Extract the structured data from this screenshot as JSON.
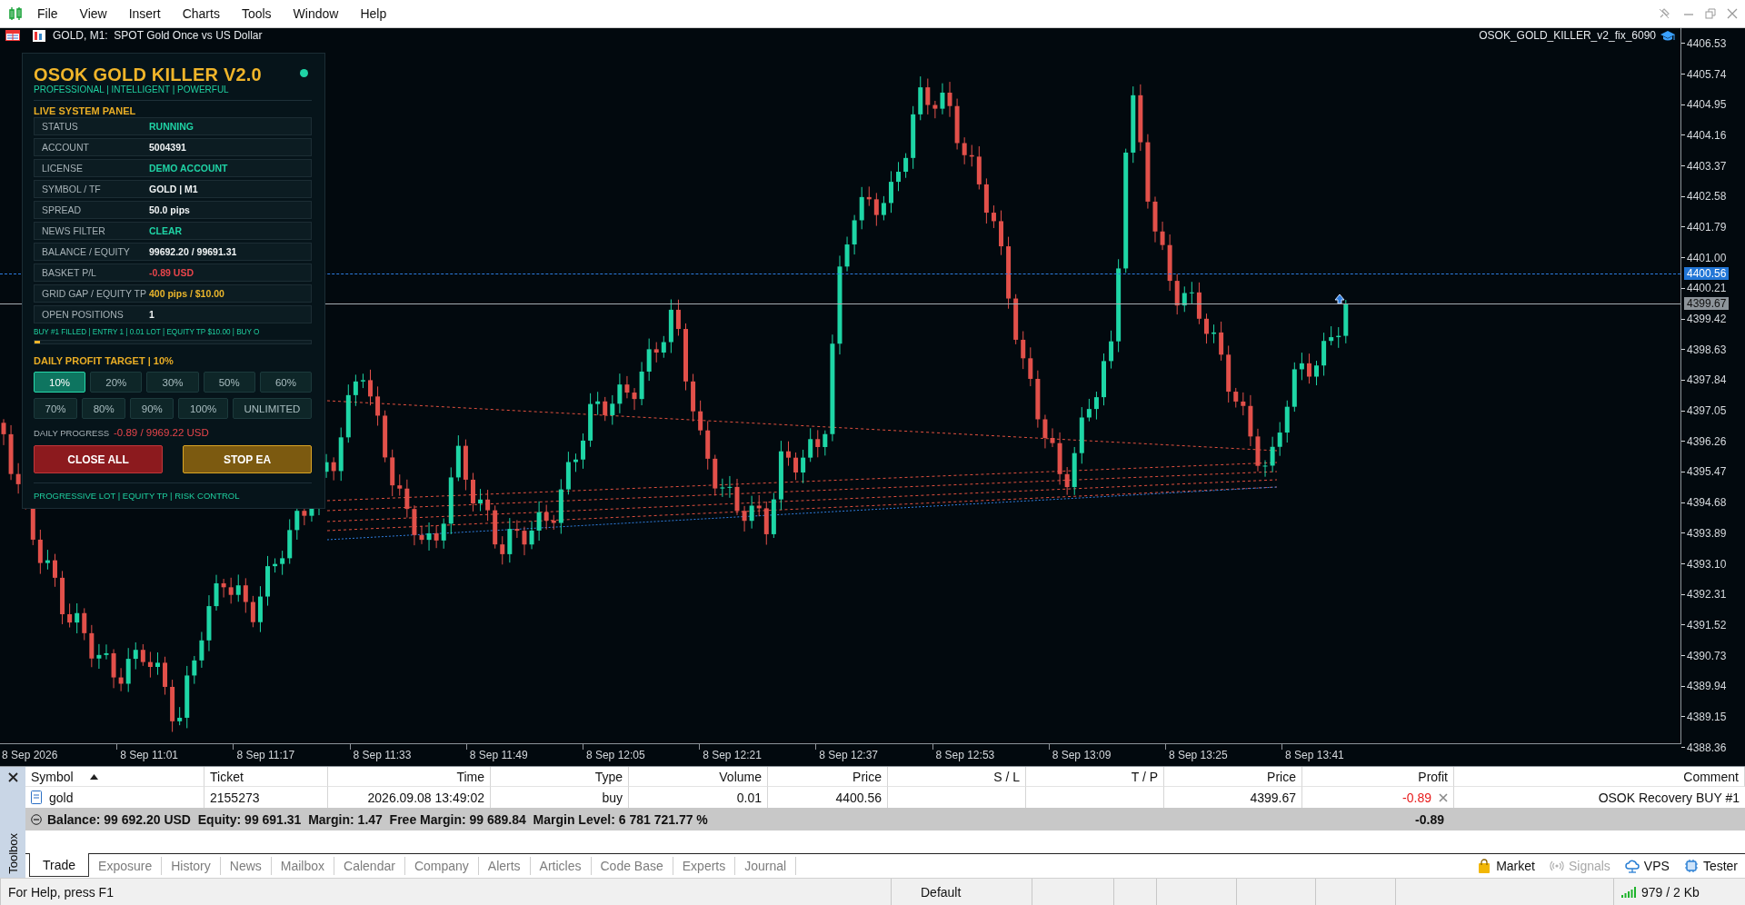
{
  "menu": {
    "items": [
      "File",
      "View",
      "Insert",
      "Charts",
      "Tools",
      "Window",
      "Help"
    ]
  },
  "chart": {
    "title": "GOLD, M1:  SPOT Gold Once vs US Dollar",
    "expert": "OSOK_GOLD_KILLER_v2_fix_6090",
    "price_ticks": [
      "4406.53",
      "4405.74",
      "4404.95",
      "4404.16",
      "4403.37",
      "4402.58",
      "4401.79",
      "4401.00",
      "4400.21",
      "4399.42",
      "4398.63",
      "4397.84",
      "4397.05",
      "4396.26",
      "4395.47",
      "4394.68",
      "4393.89",
      "4393.10",
      "4392.31",
      "4391.52",
      "4390.73",
      "4389.94",
      "4389.15",
      "4388.36"
    ],
    "time_ticks": [
      "8 Sep 2026",
      "8 Sep 11:01",
      "8 Sep 11:17",
      "8 Sep 11:33",
      "8 Sep 11:49",
      "8 Sep 12:05",
      "8 Sep 12:21",
      "8 Sep 12:37",
      "8 Sep 12:53",
      "8 Sep 13:09",
      "8 Sep 13:25",
      "8 Sep 13:41"
    ],
    "price_lines": [
      {
        "kind": "order",
        "label": "4400.56"
      },
      {
        "kind": "bid",
        "label": "4399.67"
      }
    ]
  },
  "ea_panel": {
    "title": "OSOK GOLD KILLER V2.0",
    "online": true,
    "tagline": "PROFESSIONAL | INTELLIGENT | POWERFUL",
    "section": "LIVE SYSTEM PANEL",
    "rows": [
      {
        "label": "STATUS",
        "value": "RUNNING",
        "color": "#1fd3a5"
      },
      {
        "label": "ACCOUNT",
        "value": "5004391",
        "color": "#f0f3f4"
      },
      {
        "label": "LICENSE",
        "value": "DEMO ACCOUNT",
        "color": "#1fd3a5"
      },
      {
        "label": "SYMBOL / TF",
        "value": "GOLD | M1",
        "color": "#f0f3f4"
      },
      {
        "label": "SPREAD",
        "value": "50.0 pips",
        "color": "#f0f3f4"
      },
      {
        "label": "NEWS FILTER",
        "value": "CLEAR",
        "color": "#1fd3a5"
      },
      {
        "label": "BALANCE / EQUITY",
        "value": "99692.20 / 99691.31",
        "color": "#f0f3f4"
      },
      {
        "label": "BASKET P/L",
        "value": "-0.89 USD",
        "color": "#e8454b"
      },
      {
        "label": "GRID GAP / EQUITY TP",
        "value": "400 pips / $10.00",
        "color": "#e9b52c"
      },
      {
        "label": "OPEN POSITIONS",
        "value": "1",
        "color": "#f0f3f4"
      }
    ],
    "ticker": "BUY #1 FILLED | ENTRY 1 | 0.01 LOT | EQUITY TP $10.00  |  BUY O",
    "progress": {
      "level": 0.02
    },
    "target_title": "DAILY PROFIT TARGET  |  10%",
    "target_rows": [
      {
        "options": [
          {
            "label": "10%",
            "selected": true
          },
          {
            "label": "20%",
            "selected": false
          },
          {
            "label": "30%",
            "selected": false
          },
          {
            "label": "50%",
            "selected": false
          },
          {
            "label": "60%",
            "selected": false
          }
        ]
      },
      {
        "options": [
          {
            "label": "70%",
            "selected": false
          },
          {
            "label": "80%",
            "selected": false
          },
          {
            "label": "90%",
            "selected": false
          },
          {
            "label": "100%",
            "selected": false
          },
          {
            "label": "UNLIMITED",
            "selected": false
          }
        ]
      }
    ],
    "progress_label": "DAILY PROGRESS",
    "progress_value": "-0.89 / 9969.22 USD",
    "buttons": [
      {
        "label": "CLOSE ALL",
        "kind": "danger"
      },
      {
        "label": "STOP EA",
        "kind": "warn"
      }
    ],
    "features": "PROGRESSIVE LOT  |  EQUITY TP  |  RISK CONTROL"
  },
  "toolbox": {
    "label": "Toolbox",
    "columns": [
      {
        "title": "Symbol",
        "sorted": true
      },
      {
        "title": "Ticket",
        "sorted": false
      },
      {
        "title": "Time",
        "sorted": false
      },
      {
        "title": "Type",
        "sorted": false
      },
      {
        "title": "Volume",
        "sorted": false
      },
      {
        "title": "Price",
        "sorted": false
      },
      {
        "title": "S / L",
        "sorted": false
      },
      {
        "title": "T / P",
        "sorted": false
      },
      {
        "title": "Price",
        "sorted": false
      },
      {
        "title": "Profit",
        "sorted": false
      },
      {
        "title": "Comment",
        "sorted": false
      }
    ],
    "rows": [
      {
        "symbol": "gold",
        "ticket": "2155273",
        "time": "2026.09.08 13:49:02",
        "type": "buy",
        "volume": "0.01",
        "price": "4400.56",
        "current_price": "4399.67",
        "profit": "-0.89",
        "loss": true,
        "comment": "OSOK Recovery BUY #1"
      }
    ],
    "summary": "Balance: 99 692.20 USD  Equity: 99 691.31  Margin: 1.47  Free Margin: 99 689.84  Margin Level: 6 781 721.77 %",
    "total": "-0.89",
    "tabs": [
      {
        "label": "Trade",
        "selected": true
      },
      {
        "label": "Exposure",
        "selected": false
      },
      {
        "label": "History",
        "selected": false
      },
      {
        "label": "News",
        "selected": false
      },
      {
        "label": "Mailbox",
        "selected": false
      },
      {
        "label": "Calendar",
        "selected": false
      },
      {
        "label": "Company",
        "selected": false
      },
      {
        "label": "Alerts",
        "selected": false
      },
      {
        "label": "Articles",
        "selected": false
      },
      {
        "label": "Code Base",
        "selected": false
      },
      {
        "label": "Experts",
        "selected": false
      },
      {
        "label": "Journal",
        "selected": false
      }
    ],
    "tools": [
      {
        "label": "Market",
        "kind": "market",
        "disabled": false
      },
      {
        "label": "Signals",
        "kind": "signals",
        "disabled": true
      },
      {
        "label": "VPS",
        "kind": "vps",
        "disabled": false
      },
      {
        "label": "Tester",
        "kind": "tester",
        "disabled": false
      }
    ]
  },
  "status_bar": {
    "help": "For Help, press F1",
    "profile": "Default",
    "traffic": "979 / 2 Kb"
  }
}
